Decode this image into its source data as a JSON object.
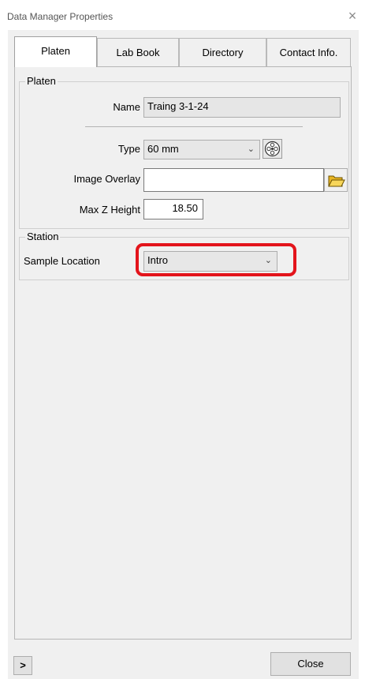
{
  "window": {
    "title": "Data Manager Properties",
    "close_glyph": "×"
  },
  "tabs": [
    {
      "label": "Platen",
      "active": true
    },
    {
      "label": "Lab Book",
      "active": false
    },
    {
      "label": "Directory",
      "active": false
    },
    {
      "label": "Contact Info.",
      "active": false
    }
  ],
  "platen_group": {
    "title": "Platen",
    "name_label": "Name",
    "name_value": "Traing 3-1-24",
    "type_label": "Type",
    "type_value": "60 mm",
    "image_overlay_label": "Image Overlay",
    "image_overlay_value": "",
    "max_z_label": "Max Z Height",
    "max_z_value": "18.50"
  },
  "station_group": {
    "title": "Station",
    "sample_location_label": "Sample Location",
    "sample_location_value": "Intro"
  },
  "footer": {
    "expand_glyph": ">",
    "close_label": "Close"
  },
  "colors": {
    "highlight": "#e3141b",
    "dialog_bg": "#f0f0f0",
    "folder_icon": "#e8b422"
  },
  "icons": [
    "close-icon",
    "platen-type-icon",
    "open-folder-icon",
    "chevron-down-icon",
    "expand-icon"
  ]
}
